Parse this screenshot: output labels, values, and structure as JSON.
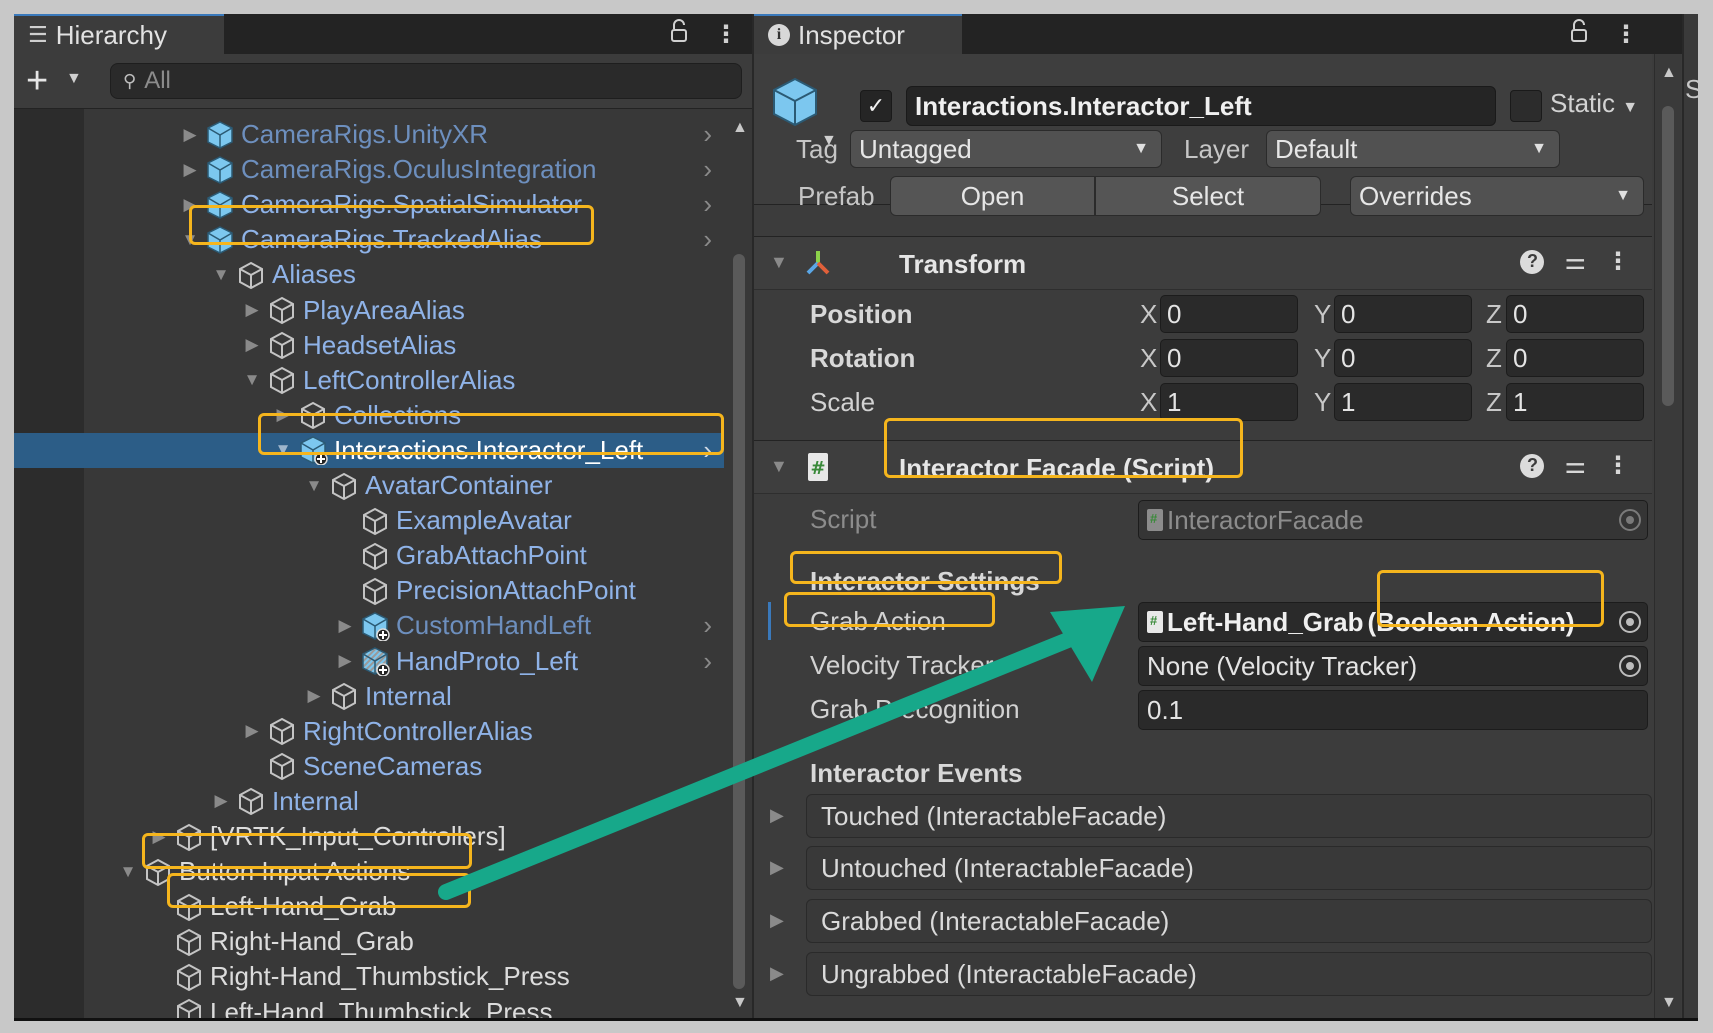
{
  "hierarchy": {
    "tab_label": "Hierarchy",
    "tab_icon": "list-icon",
    "search_placeholder": "All",
    "add_button": "+",
    "rows": [
      {
        "label": "CameraRigs.UnityXR",
        "depth": 0,
        "fold": "collapsed",
        "icon": "prefab-icon",
        "style": "dim",
        "has_go": true
      },
      {
        "label": "CameraRigs.OculusIntegration",
        "depth": 0,
        "fold": "collapsed",
        "icon": "prefab-icon",
        "style": "dim",
        "has_go": true
      },
      {
        "label": "CameraRigs.SpatialSimulator",
        "depth": 0,
        "fold": "collapsed",
        "icon": "prefab-icon",
        "style": "blue",
        "has_go": true
      },
      {
        "label": "CameraRigs.TrackedAlias",
        "depth": 0,
        "fold": "expanded",
        "icon": "prefab-icon",
        "style": "blue",
        "has_go": true,
        "highlighted": true
      },
      {
        "label": "Aliases",
        "depth": 1,
        "fold": "expanded",
        "icon": "gameobject-icon",
        "style": "blue"
      },
      {
        "label": "PlayAreaAlias",
        "depth": 2,
        "fold": "collapsed",
        "icon": "gameobject-icon",
        "style": "blue"
      },
      {
        "label": "HeadsetAlias",
        "depth": 2,
        "fold": "collapsed",
        "icon": "gameobject-icon",
        "style": "blue"
      },
      {
        "label": "LeftControllerAlias",
        "depth": 2,
        "fold": "expanded",
        "icon": "gameobject-icon",
        "style": "blue"
      },
      {
        "label": "Collections",
        "depth": 3,
        "fold": "collapsed",
        "icon": "gameobject-icon",
        "style": "blue"
      },
      {
        "label": "Interactions.Interactor_Left",
        "depth": 3,
        "fold": "expanded",
        "icon": "prefab-added-icon",
        "style": "selected",
        "has_go": true,
        "selected": true,
        "highlighted": true
      },
      {
        "label": "AvatarContainer",
        "depth": 4,
        "fold": "expanded",
        "icon": "gameobject-icon",
        "style": "blue"
      },
      {
        "label": "ExampleAvatar",
        "depth": 5,
        "fold": "none",
        "icon": "gameobject-icon",
        "style": "blue"
      },
      {
        "label": "GrabAttachPoint",
        "depth": 5,
        "fold": "none",
        "icon": "gameobject-icon",
        "style": "blue"
      },
      {
        "label": "PrecisionAttachPoint",
        "depth": 5,
        "fold": "none",
        "icon": "gameobject-icon",
        "style": "blue"
      },
      {
        "label": "CustomHandLeft",
        "depth": 5,
        "fold": "collapsed",
        "icon": "prefab-added-icon",
        "style": "dim",
        "has_go": true
      },
      {
        "label": "HandProto_Left",
        "depth": 5,
        "fold": "collapsed",
        "icon": "prefab-variant-added-icon",
        "style": "blue",
        "has_go": true
      },
      {
        "label": "Internal",
        "depth": 4,
        "fold": "collapsed",
        "icon": "gameobject-icon",
        "style": "blue"
      },
      {
        "label": "RightControllerAlias",
        "depth": 2,
        "fold": "collapsed",
        "icon": "gameobject-icon",
        "style": "blue"
      },
      {
        "label": "SceneCameras",
        "depth": 2,
        "fold": "none",
        "icon": "gameobject-icon",
        "style": "blue"
      },
      {
        "label": "Internal",
        "depth": 1,
        "fold": "collapsed",
        "icon": "gameobject-icon",
        "style": "blue"
      },
      {
        "label": "[VRTK_Input_Controllers]",
        "depth": -1,
        "fold": "collapsed",
        "icon": "gameobject-icon",
        "style": "white"
      },
      {
        "label": "Button Input Actions",
        "depth": -2,
        "fold": "expanded",
        "icon": "gameobject-icon",
        "style": "white",
        "highlighted": true
      },
      {
        "label": "Left-Hand_Grab",
        "depth": -1,
        "fold": "none",
        "icon": "gameobject-icon",
        "style": "white",
        "highlighted": true
      },
      {
        "label": "Right-Hand_Grab",
        "depth": -1,
        "fold": "none",
        "icon": "gameobject-icon",
        "style": "white"
      },
      {
        "label": "Right-Hand_Thumbstick_Press",
        "depth": -1,
        "fold": "none",
        "icon": "gameobject-icon",
        "style": "white"
      },
      {
        "label": "Left-Hand_Thumbstick_Press",
        "depth": -1,
        "fold": "none",
        "icon": "gameobject-icon",
        "style": "white"
      }
    ]
  },
  "inspector": {
    "tab_label": "Inspector",
    "tab_icon": "info-icon",
    "object": {
      "active": true,
      "active_mark": "✓",
      "name": "Interactions.Interactor_Left",
      "static_label": "Static",
      "static_checked": false,
      "tag_label": "Tag",
      "tag_value": "Untagged",
      "layer_label": "Layer",
      "layer_value": "Default",
      "prefab_label": "Prefab",
      "open_button": "Open",
      "select_button": "Select",
      "overrides_value": "Overrides"
    },
    "transform": {
      "title": "Transform",
      "rows": [
        {
          "label": "Position",
          "x": "0",
          "y": "0",
          "z": "0"
        },
        {
          "label": "Rotation",
          "x": "0",
          "y": "0",
          "z": "0"
        },
        {
          "label": "Scale",
          "x": "1",
          "y": "1",
          "z": "1"
        }
      ],
      "axis_labels": {
        "x": "X",
        "y": "Y",
        "z": "Z"
      }
    },
    "script_component": {
      "title": "Interactor Facade (Script)",
      "script_label": "Script",
      "script_value": "InteractorFacade",
      "settings_header": "Interactor Settings",
      "grab_action_label": "Grab Action",
      "grab_action_value": "Left-Hand_Grab",
      "grab_action_type": "(Boolean Action)",
      "velocity_tracker_label": "Velocity Tracker",
      "velocity_tracker_value": "None (Velocity Tracker)",
      "grab_precognition_label": "Grab Precognition",
      "grab_precognition_value": "0.1",
      "events_header": "Interactor Events",
      "events": [
        "Touched (InteractableFacade)",
        "Untouched (InteractableFacade)",
        "Grabbed (InteractableFacade)",
        "Ungrabbed (InteractableFacade)"
      ]
    }
  },
  "side_panel": {
    "partial_label": "S"
  },
  "annotation": {
    "highlight_color": "#f5b51d",
    "arrow_color": "#17a88a",
    "arrow_from": "Left-Hand_Grab (Hierarchy)",
    "arrow_to": "Grab Action field"
  }
}
